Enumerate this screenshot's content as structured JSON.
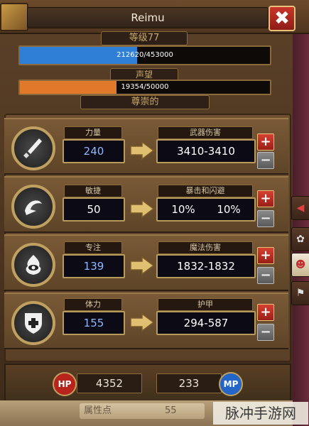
{
  "window": {
    "title": "Reimu",
    "close_glyph": "✖"
  },
  "level": {
    "label": "等级77",
    "current": 212620,
    "max": 453000,
    "text": "212620/453000",
    "color": "#2f7fd6"
  },
  "reputation": {
    "label": "声望",
    "current": 19354,
    "max": 50000,
    "text": "19354/50000",
    "rank": "尊崇的",
    "color": "#e07a2a"
  },
  "stats": [
    {
      "icon": "sword-icon",
      "label": "力量",
      "value": "240",
      "derived_label": "武器伤害",
      "derived_value": "3410-3410",
      "derived_value_2": ""
    },
    {
      "icon": "agility-icon",
      "label": "敏捷",
      "value": "50",
      "derived_label": "暴击和闪避",
      "derived_value": "10%",
      "derived_value_2": "10%"
    },
    {
      "icon": "eye-fire-icon",
      "label": "专注",
      "value": "139",
      "derived_label": "魔法伤害",
      "derived_value": "1832-1832",
      "derived_value_2": ""
    },
    {
      "icon": "health-shield-icon",
      "label": "体力",
      "value": "155",
      "derived_label": "护甲",
      "derived_value": "294-587",
      "derived_value_2": ""
    }
  ],
  "buttons": {
    "plus": "+",
    "minus": "−"
  },
  "resources": {
    "hp_label": "HP",
    "hp_value": "4352",
    "mp_label": "MP",
    "mp_value": "233",
    "hp_color": "#b8231b",
    "mp_color": "#2466c8"
  },
  "attributes": {
    "label": "属性点",
    "value": "55"
  },
  "side_tabs": [
    {
      "icon": "arrow-left-icon",
      "glyph": "◀"
    },
    {
      "icon": "paw-icon",
      "glyph": "✿"
    },
    {
      "icon": "character-icon",
      "glyph": "☻"
    },
    {
      "icon": "bookmark-icon",
      "glyph": "⚑"
    }
  ],
  "watermark": "脉冲手游网"
}
